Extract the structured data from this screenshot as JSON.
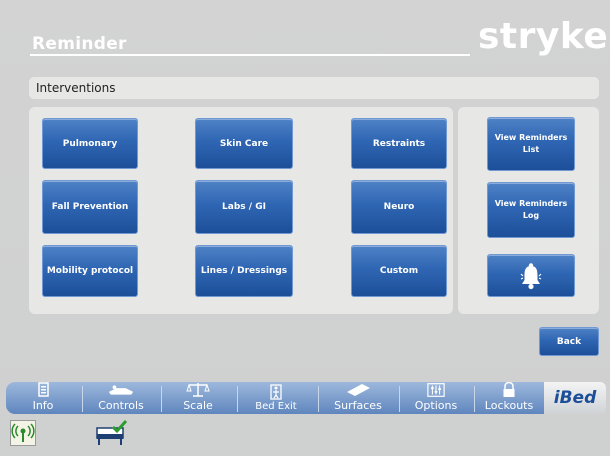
{
  "header": {
    "title": "Reminder",
    "logo": "stryker"
  },
  "section": {
    "title": "Interventions"
  },
  "interventions": {
    "pulmonary": "Pulmonary",
    "skin_care": "Skin Care",
    "restraints": "Restraints",
    "fall_prevention": "Fall Prevention",
    "labs_gi": "Labs / GI",
    "neuro": "Neuro",
    "mobility": "Mobility protocol",
    "lines_dressings": "Lines / Dressings",
    "custom": "Custom"
  },
  "reminders": {
    "view_list": "View Reminders List",
    "view_log": "View Reminders Log",
    "bell_icon": "bell-icon"
  },
  "back": "Back",
  "tabs": [
    {
      "label": "Info",
      "icon": "info-icon"
    },
    {
      "label": "Controls",
      "icon": "controls-icon"
    },
    {
      "label": "Scale",
      "icon": "scale-icon"
    },
    {
      "label": "Bed Exit",
      "icon": "bed-exit-icon"
    },
    {
      "label": "Surfaces",
      "icon": "surfaces-icon"
    },
    {
      "label": "Options",
      "icon": "options-icon"
    },
    {
      "label": "Lockouts",
      "icon": "lock-icon"
    }
  ],
  "ibed": "iBed",
  "status_icons": [
    "wireless-icon",
    "bed-status-check-icon"
  ],
  "colors": {
    "button_blue": "#2f66b3",
    "panel": "#e7e7e6",
    "background": "#d3d3d3"
  }
}
